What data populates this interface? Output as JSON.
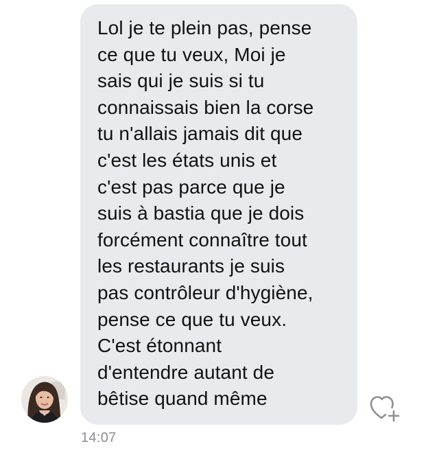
{
  "message": {
    "text": "Lol je te plein pas, pense\nce que tu veux, Moi je\nsais qui je suis si tu\nconnaissais bien la corse\ntu n'allais jamais dit que\nc'est les états unis et\nc'est pas parce que je\nsuis à bastia que je dois\nforcément connaître tout\nles restaurants je suis\npas contrôleur d'hygiène,\npense ce que tu veux.\nC'est étonnant\nd'entendre autant de\nbêtise quand même",
    "timestamp": "14:07",
    "avatar_icon": "avatar-photo",
    "reaction_icon": "heart-plus-icon"
  },
  "colors": {
    "bubble_background": "#e9eaee",
    "text": "#111111",
    "timestamp": "#8e8e93",
    "icon": "#8e8e93"
  }
}
